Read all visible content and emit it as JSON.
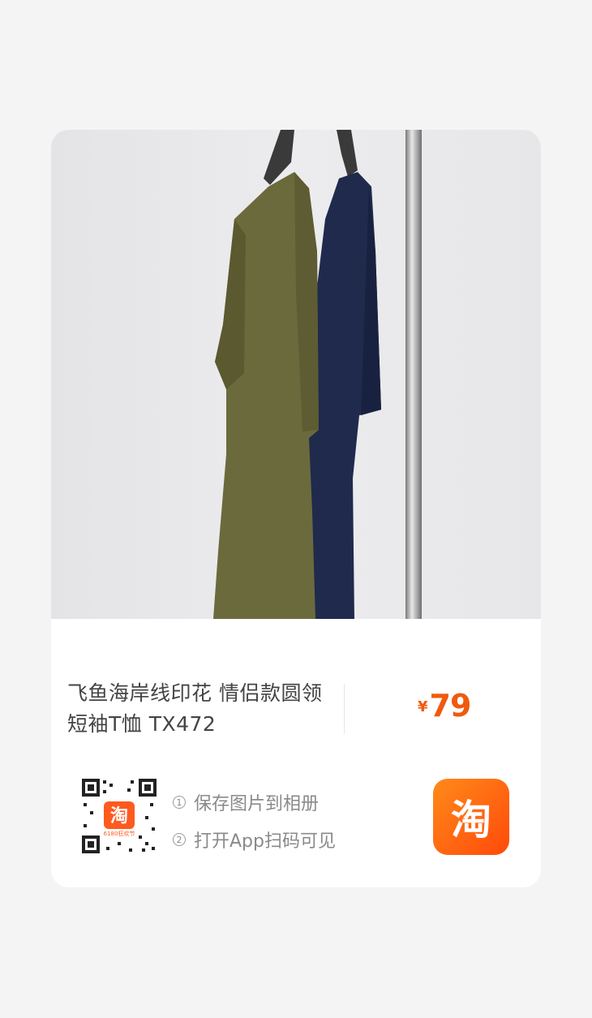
{
  "product": {
    "title": "飞鱼海岸线印花 情侣款圆领短袖T恤 TX472",
    "price_symbol": "¥",
    "price": "79"
  },
  "qr": {
    "logo_text": "淘",
    "logo_caption": "6180狂欢节"
  },
  "steps": [
    {
      "num": "1",
      "text": "保存图片到相册"
    },
    {
      "num": "2",
      "text": "打开App扫码可见"
    }
  ],
  "app_badge": {
    "text": "淘"
  },
  "colors": {
    "accent": "#f05a0e",
    "badge": "#ff6a10",
    "shirt_olive": "#6b6a3c",
    "shirt_navy": "#1f2a4d"
  }
}
